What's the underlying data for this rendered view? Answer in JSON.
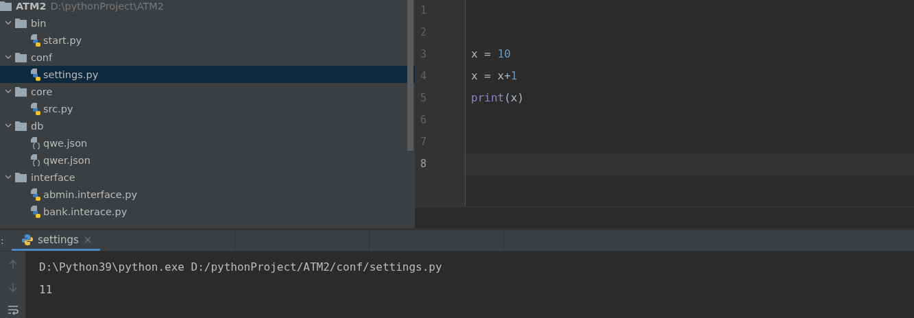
{
  "project_tree": {
    "root": {
      "name": "ATM2",
      "path": "D:\\pythonProject\\ATM2",
      "children": [
        {
          "name": "bin",
          "kind": "folder",
          "expanded": true,
          "selected": false,
          "children": [
            {
              "name": "start.py",
              "kind": "python",
              "selected": false
            }
          ]
        },
        {
          "name": "conf",
          "kind": "folder",
          "expanded": true,
          "selected": false,
          "children": [
            {
              "name": "settings.py",
              "kind": "python",
              "selected": true
            }
          ]
        },
        {
          "name": "core",
          "kind": "folder",
          "expanded": true,
          "selected": false,
          "children": [
            {
              "name": "src.py",
              "kind": "python",
              "selected": false
            }
          ]
        },
        {
          "name": "db",
          "kind": "folder",
          "expanded": true,
          "selected": false,
          "children": [
            {
              "name": "qwe.json",
              "kind": "json",
              "selected": false
            },
            {
              "name": "qwer.json",
              "kind": "json",
              "selected": false
            }
          ]
        },
        {
          "name": "interface",
          "kind": "folder",
          "expanded": true,
          "selected": false,
          "children": [
            {
              "name": "abmin.interface.py",
              "kind": "python",
              "selected": false
            },
            {
              "name": "bank.interace.py",
              "kind": "python",
              "selected": false
            }
          ]
        }
      ]
    }
  },
  "editor": {
    "lines": [
      {
        "number": "1",
        "current": false
      },
      {
        "number": "2",
        "current": false
      },
      {
        "number": "3",
        "current": false,
        "tokens": [
          {
            "kind": "ident",
            "text": "x = "
          },
          {
            "kind": "number",
            "text": "10"
          }
        ]
      },
      {
        "number": "4",
        "current": false,
        "tokens": [
          {
            "kind": "ident",
            "text": "x = x+"
          },
          {
            "kind": "number",
            "text": "1"
          }
        ]
      },
      {
        "number": "5",
        "current": false,
        "tokens": [
          {
            "kind": "builtin",
            "text": "print"
          },
          {
            "kind": "ident",
            "text": "(x)"
          }
        ]
      },
      {
        "number": "6",
        "current": false
      },
      {
        "number": "7",
        "current": false
      },
      {
        "number": "8",
        "current": true
      }
    ]
  },
  "run_panel": {
    "label": ":",
    "tabs": [
      {
        "title": "settings",
        "selected": true,
        "close": "×"
      }
    ],
    "output": [
      "D:\\Python39\\python.exe D:/pythonProject/ATM2/conf/settings.py",
      "11"
    ]
  }
}
